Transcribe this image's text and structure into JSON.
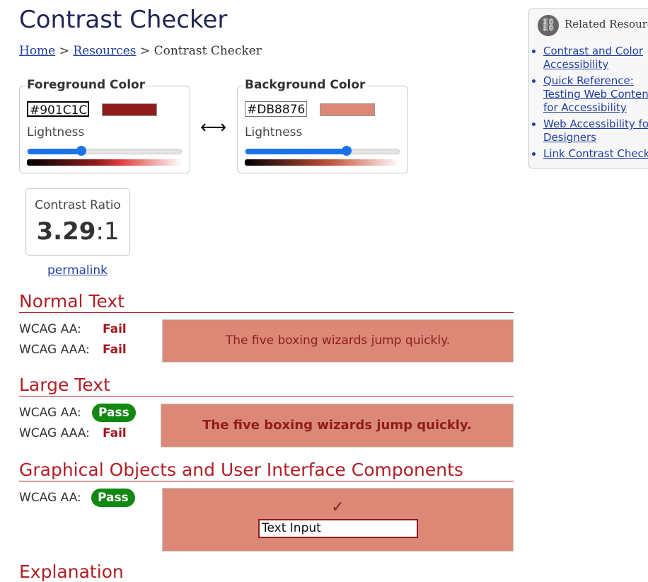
{
  "page": {
    "title": "Contrast Checker"
  },
  "breadcrumb": {
    "home": "Home",
    "sep1": ">",
    "resources": "Resources",
    "sep2": ">",
    "current": "Contrast Checker"
  },
  "foreground": {
    "legend": "Foreground Color",
    "hex": "#901C1C",
    "swatch_color": "#901c1c",
    "lightness_label": "Lightness",
    "lightness_level": 0.35
  },
  "background": {
    "legend": "Background Color",
    "hex": "#DB8876",
    "swatch_color": "#db8876",
    "lightness_label": "Lightness",
    "lightness_level": 0.66
  },
  "swap_glyph": "⟷",
  "contrast": {
    "label": "Contrast Ratio",
    "ratio_bold": "3.29",
    "ratio_suffix": ":1"
  },
  "permalink": "permalink",
  "sections": {
    "normal": {
      "heading": "Normal Text",
      "aa_label": "WCAG AA:",
      "aa_result": "Fail",
      "aaa_label": "WCAG AAA:",
      "aaa_result": "Fail",
      "sample": "The five boxing wizards jump quickly."
    },
    "large": {
      "heading": "Large Text",
      "aa_label": "WCAG AA:",
      "aa_result": "Pass",
      "aaa_label": "WCAG AAA:",
      "aaa_result": "Fail",
      "sample": "The five boxing wizards jump quickly."
    },
    "graphical": {
      "heading": "Graphical Objects and User Interface Components",
      "aa_label": "WCAG AA:",
      "aa_result": "Pass",
      "check_glyph": "✓",
      "input_value": "Text Input"
    },
    "explanation": {
      "heading": "Explanation"
    }
  },
  "related": {
    "title": "Related Resources",
    "icon": "link-icon",
    "items": [
      "Contrast and Color Accessibility",
      "Quick Reference: Testing Web Content for Accessibility",
      "Web Accessibility for Designers",
      "Link Contrast Checker"
    ]
  },
  "colors": {
    "title": "#1f2455",
    "heading_red": "#b01f26",
    "link_blue": "#1f3fa0",
    "pass_green": "#118811",
    "slider_blue": "#1a73e8"
  }
}
